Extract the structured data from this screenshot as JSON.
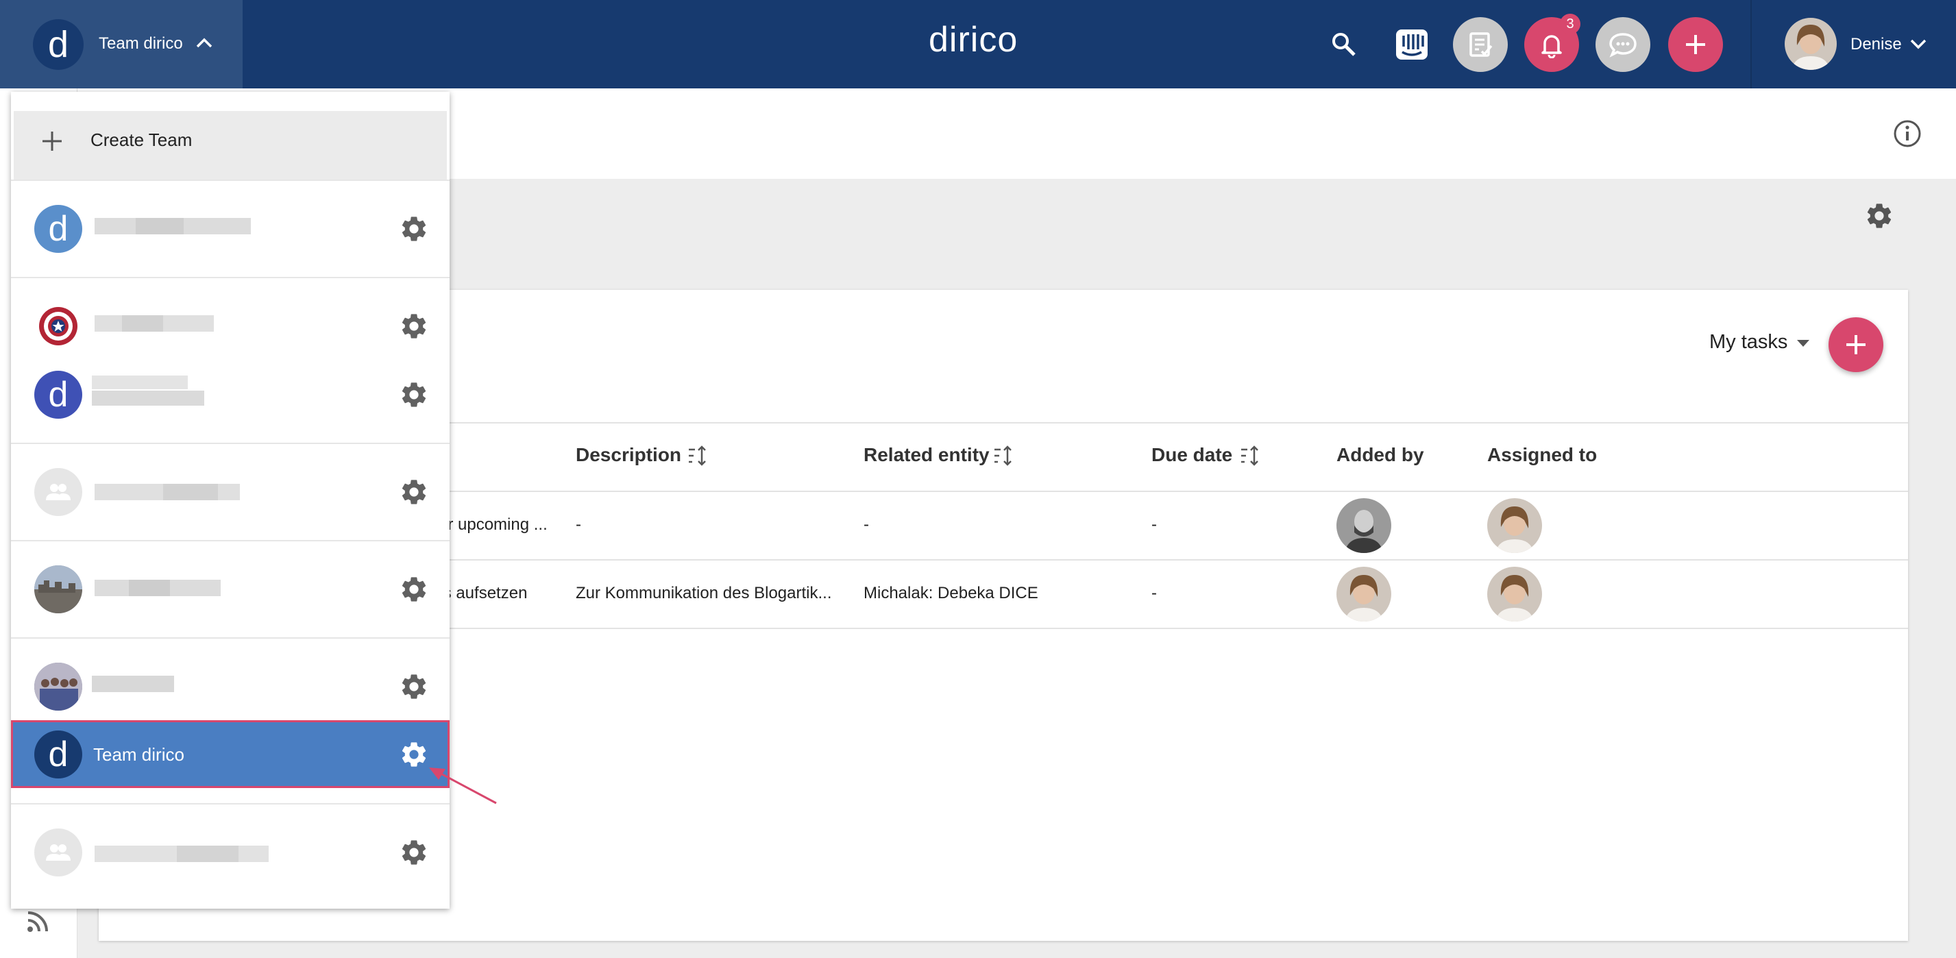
{
  "header": {
    "current_team": "Team dirico",
    "team_logo_letter": "d",
    "brand": "dirico",
    "notification_count": "3",
    "user_name": "Denise",
    "colors": {
      "topbar": "#173a6f",
      "accent": "#d8476d",
      "grey_button": "#c8c8c8"
    }
  },
  "team_menu": {
    "create_label": "Create Team",
    "teams": [
      {
        "name": "",
        "logo": "d-logo-lightblue",
        "blurred": true
      },
      {
        "name": "",
        "logo": "shield-star-logo",
        "blurred": true
      },
      {
        "name": "",
        "logo": "d-logo-indigo",
        "blurred": true
      },
      {
        "name": "",
        "logo": "group-placeholder",
        "blurred": true
      },
      {
        "name": "",
        "logo": "city-photo",
        "blurred": true
      },
      {
        "name": "",
        "logo": "group-photo",
        "blurred": true
      },
      {
        "name": "Team dirico",
        "logo": "d-logo-navy",
        "selected": true
      },
      {
        "name": "",
        "logo": "group-placeholder",
        "blurred": true
      }
    ]
  },
  "tasks": {
    "filter_label": "My tasks",
    "columns": {
      "description": "Description",
      "related_entity": "Related entity",
      "due_date": "Due date",
      "added_by": "Added by",
      "assigned_to": "Assigned to"
    },
    "rows": [
      {
        "title_fragment": "or upcoming ...",
        "description": "-",
        "related_entity": "-",
        "due_date": "-"
      },
      {
        "title_fragment": "ts aufsetzen",
        "description": "Zur Kommunikation des Blogartik...",
        "related_entity": "Michalak: Debeka DICE",
        "due_date": "-"
      }
    ]
  }
}
